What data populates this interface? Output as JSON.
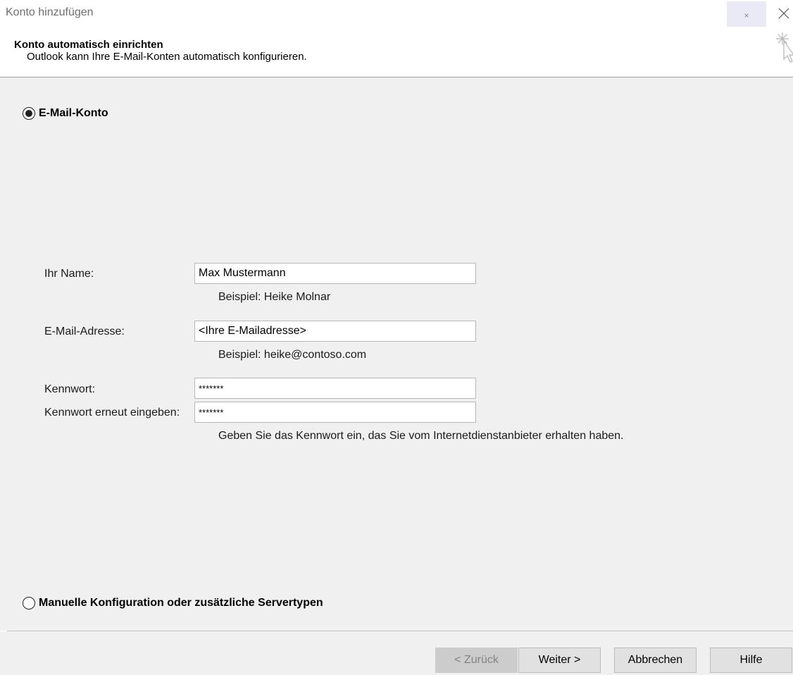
{
  "window": {
    "title": "Konto hinzufügen",
    "help_glyph": "×",
    "close_glyph": "✕"
  },
  "header": {
    "title": "Konto automatisch einrichten",
    "subtitle": "Outlook kann Ihre E-Mail-Konten automatisch konfigurieren."
  },
  "options": {
    "email_account": {
      "label": "E-Mail-Konto",
      "selected": true
    },
    "manual_config": {
      "label": "Manuelle Konfiguration oder zusätzliche Servertypen",
      "selected": false
    }
  },
  "form": {
    "name": {
      "label": "Ihr Name:",
      "value": "Max Mustermann",
      "hint": "Beispiel: Heike Molnar"
    },
    "email": {
      "label": "E-Mail-Adresse:",
      "value": "<Ihre E-Mailadresse>",
      "hint": "Beispiel: heike@contoso.com"
    },
    "password": {
      "label": "Kennwort:",
      "value": "*******"
    },
    "password_confirm": {
      "label": "Kennwort erneut eingeben:",
      "value": "*******"
    },
    "password_hint": "Geben Sie das Kennwort ein, das Sie vom Internetdienstanbieter erhalten haben."
  },
  "footer": {
    "back_label": "< Zurück",
    "next_label": "Weiter >",
    "cancel_label": "Abbrechen",
    "help_label": "Hilfe"
  },
  "colors": {
    "content_bg": "#f0f0f0",
    "button_bg": "#e1e1e1",
    "disabled_button_bg": "#cccccc",
    "help_button_bg": "#eaeaf7"
  }
}
